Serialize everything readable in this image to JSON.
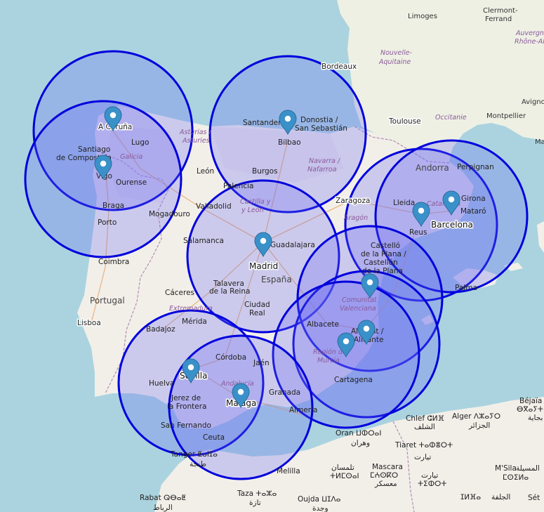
{
  "map": {
    "circle_color": "#0000dd",
    "circle_fill": "#6c6cf5",
    "marker_color": "#3a91c9",
    "land_color": "#f2efe9",
    "water_color": "#aad3df",
    "markers": [
      {
        "name": "A Coruña marker",
        "icon": "map-pin-icon"
      },
      {
        "name": "Vigo marker",
        "icon": "map-pin-icon"
      },
      {
        "name": "Bilbao marker",
        "icon": "map-pin-icon"
      },
      {
        "name": "Madrid marker",
        "icon": "map-pin-icon"
      },
      {
        "name": "Barcelona marker",
        "icon": "map-pin-icon"
      },
      {
        "name": "Reus marker",
        "icon": "map-pin-icon"
      },
      {
        "name": "Valencia marker",
        "icon": "map-pin-icon"
      },
      {
        "name": "Alicante marker",
        "icon": "map-pin-icon"
      },
      {
        "name": "Murcia marker",
        "icon": "map-pin-icon"
      },
      {
        "name": "Sevilla marker",
        "icon": "map-pin-icon"
      },
      {
        "name": "Málaga marker",
        "icon": "map-pin-icon"
      }
    ],
    "labels": {
      "limoges": "Limoges",
      "clermont": "Clermont-",
      "ferrand": "Ferrand",
      "auvergne": "Auvergne",
      "rhone": "Rhône-Alpes",
      "nouvelle": "Nouvelle-",
      "aquitaine": "Aquitaine",
      "bordeaux": "Bordeaux",
      "toulouse": "Toulouse",
      "occitanie": "Occitanie",
      "montpellier": "Montpellier",
      "avignon": "Avigno",
      "ma": "Ma",
      "acoruna": "A Coruña",
      "lugo": "Lugo",
      "santiago": "Santiago",
      "decompostela": "de Compostela",
      "galicia": "Galicia",
      "vigo": "Vigo",
      "ourense": "Ourense",
      "braga": "Braga",
      "porto": "Porto",
      "coimbra": "Coimbra",
      "asturias1": "Asturias /",
      "asturias2": "Asturies",
      "santander": "Santander",
      "donostia": "Donostia /",
      "sansebastian": "San Sebastián",
      "bilbao": "Bilbao",
      "navarra": "Navarra /",
      "nafarroa": "Nafarroa",
      "leon": "León",
      "burgos": "Burgos",
      "palencia": "Palencia",
      "valladolid": "Valladolid",
      "castilla": "Castilla y",
      "yleon": "y León",
      "mogadouro": "Mogadouro",
      "salamanca": "Salamanca",
      "guadalajara": "Guadalajara",
      "madrid": "Madrid",
      "espana": "España",
      "talavera1": "Talavera",
      "talavera2": "de la Reina",
      "ciudad1": "Ciudad",
      "ciudad2": "Real",
      "caceres": "Cáceres",
      "portugal": "Portugal",
      "extremadura": "Extremadura",
      "lisboa": "Lisboa",
      "merida": "Mérida",
      "badajoz": "Badajoz",
      "zaragoza": "Zaragoza",
      "aragon": "Aragón",
      "andorra": "Andorra",
      "perpignan": "Perpignan",
      "lleida": "Lleida",
      "catalunya": "Catalunya",
      "girona": "Girona",
      "mataro": "Mataró",
      "barcelona": "Barcelona",
      "reus": "Reus",
      "castello1": "Castelló",
      "castello2": "de la Plana /",
      "castello3": "Castellón",
      "castello4": "de la Plana",
      "palma": "Palma",
      "comunitat1": "Comunitat",
      "comunitat2": "Valenciana",
      "albacete": "Albacete",
      "alacant": "Alacant /",
      "alicante": "Alicante",
      "regionmurcia1": "Región de",
      "regionmurcia2": "Murcia",
      "cartagena": "Cartagena",
      "cordoba": "Córdoba",
      "jaen": "Jaén",
      "sevilla": "Sevilla",
      "huelva": "Huelva",
      "andalucia": "Andalucía",
      "granada": "Granada",
      "jerez1": "Jerez de",
      "jerez2": "la Frontera",
      "malaga": "Málaga",
      "almeria": "Almería",
      "sanfernando": "San Fernando",
      "ceuta": "Ceuta",
      "tanger": "Tanger ⵟⴰⵏⵊⴰ",
      "tanger_ar": "طنجة",
      "oran": "Oran ⵡⵀⵔⴰⵏ",
      "oran_ar": "وهران",
      "chlef": "Chlef ⵛⵍⴼ",
      "chlef_ar": "الشلف",
      "alger": "Alger ⴷⵣⴰⵢⵔ",
      "alger_ar": "الجزائر",
      "bejaia": "Béjaïa",
      "bejaia2": "ⴱⴳⴰⵢⵜ",
      "bejaia_ar": "بجاية",
      "tiaret": "Tiaret ⵜⴰⵀⴻⵔⵜ",
      "tiaret_ar": "تيارت",
      "tlemcen": "تلمسان",
      "tlemcen2": "ⵜⵍⵎⵙⴰⵏ",
      "mascara": "Mascara",
      "mascara2": "ⵎⵄⵙⴽⵔ",
      "mascara_ar": "معسكر",
      "tissemsilt": "تيارت",
      "tissemsilt2": "ⵜⵉⵀⵔⵜ",
      "msila": "M'Sila",
      "msila_ar": "المسيلة",
      "msila2": "ⵎⵙⵉⵍⴰ",
      "djelfa": "ⵊⵍⴼⴰ",
      "djelfa_ar": "الجلفة",
      "melilla": "Melilla",
      "rabat": "Rabat ⵕⴱⴰⵟ",
      "rabat_ar": "الرباط",
      "taza": "Taza ⵜⴰⵣⴰ",
      "taza_ar": "تازة",
      "oujda": "Oujda ⵡⵊⴷⴰ",
      "oujda_ar": "وجدة",
      "sat": "Sét"
    }
  }
}
